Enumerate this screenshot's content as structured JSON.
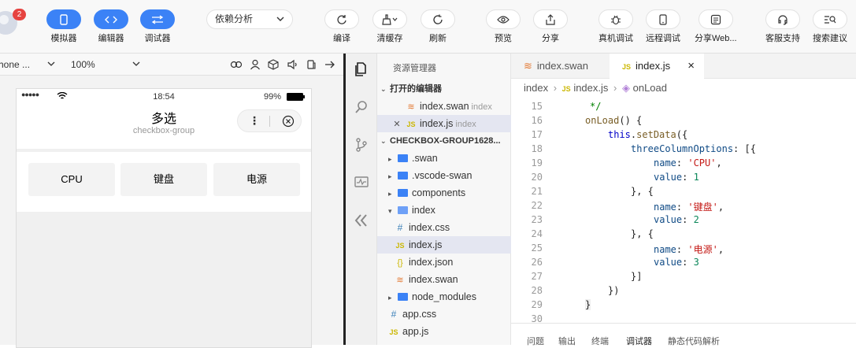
{
  "toolbar": {
    "badge": "2",
    "simulator": "模拟器",
    "editor": "编辑器",
    "debugger": "调试器",
    "deps": "依赖分析",
    "compile": "编译",
    "clear_cache": "清缓存",
    "refresh": "刷新",
    "preview": "预览",
    "share": "分享",
    "real_debug": "真机调试",
    "remote_debug": "远程调试",
    "share_web": "分享Web...",
    "support": "客服支持",
    "feedback": "搜索建议"
  },
  "simbar": {
    "device": "hone ...",
    "zoom": "100%"
  },
  "phone": {
    "signal": "●●●●●",
    "time": "18:54",
    "battery": "99%",
    "title": "多选",
    "subtitle": "checkbox-group",
    "menu_dots": "⋮",
    "options": [
      "CPU",
      "键盘",
      "电源"
    ]
  },
  "explorer": {
    "title": "资源管理器",
    "open_editors": "打开的编辑器",
    "open_files": [
      {
        "name": "index.swan",
        "hint": "index"
      },
      {
        "name": "index.js",
        "hint": "index"
      }
    ],
    "project": "CHECKBOX-GROUP1628...",
    "tree": [
      ".swan",
      ".vscode-swan",
      "components",
      "index",
      "index.css",
      "index.js",
      "index.json",
      "index.swan",
      "node_modules",
      "app.css",
      "app.js"
    ],
    "icons": {
      "swan": "≋",
      "js": "JS",
      "css": "#",
      "json": "{}"
    }
  },
  "editor": {
    "tabs": [
      "index.swan",
      "index.js"
    ],
    "close": "×",
    "breadcrumb": [
      "index",
      "index.js",
      "onLoad"
    ],
    "line_numbers": [
      "15",
      "16",
      "17",
      "18",
      "19",
      "20",
      "21",
      "22",
      "23",
      "24",
      "25",
      "26",
      "27",
      "28",
      "29",
      "30"
    ],
    "code": {
      "l15": "*/",
      "l16a": "onLoad",
      "l16b": "() {",
      "l17a": "this",
      "l17b": ".",
      "l17c": "setData",
      "l17d": "({",
      "l18a": "threeColumnOptions",
      "l18b": ": [{",
      "name": "name",
      "value": "value",
      "v1": "'CPU'",
      "n1": "1",
      "v2": "'键盘'",
      "n2": "2",
      "v3": "'电源'",
      "n3": "3",
      "sep": "}, {",
      "close1": "}]",
      "close2": "})",
      "close3": "}",
      "colon": ": ",
      "comma": ","
    }
  },
  "bottom_tabs": [
    "问题",
    "输出",
    "终端",
    "调试器",
    "静态代码解析"
  ]
}
